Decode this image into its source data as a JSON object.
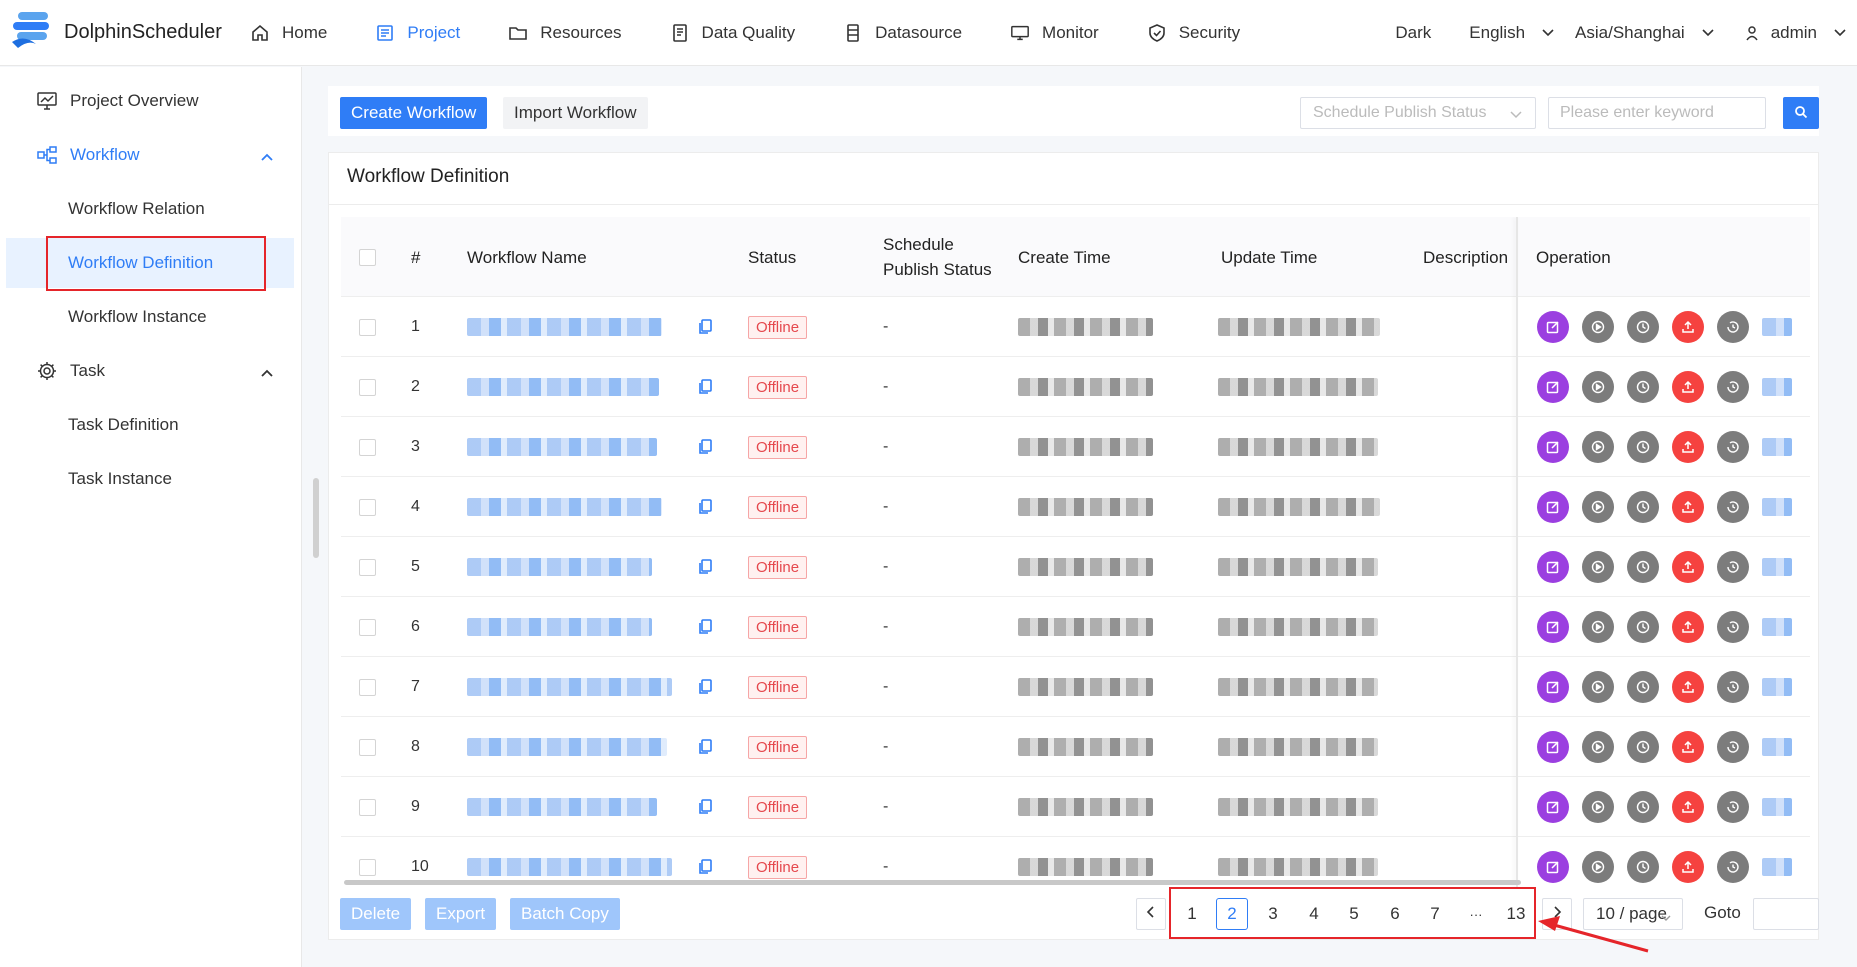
{
  "app": {
    "name": "DolphinScheduler"
  },
  "nav": [
    {
      "label": "Home",
      "icon": "home-icon"
    },
    {
      "label": "Project",
      "icon": "project-icon",
      "active": true
    },
    {
      "label": "Resources",
      "icon": "folder-icon"
    },
    {
      "label": "Data Quality",
      "icon": "data-quality-icon"
    },
    {
      "label": "Datasource",
      "icon": "datasource-icon"
    },
    {
      "label": "Monitor",
      "icon": "monitor-icon"
    },
    {
      "label": "Security",
      "icon": "shield-icon"
    }
  ],
  "header_right": {
    "theme": "Dark",
    "language": "English",
    "timezone": "Asia/Shanghai",
    "user": "admin"
  },
  "sidebar": {
    "project_overview": "Project Overview",
    "workflow": "Workflow",
    "workflow_relation": "Workflow Relation",
    "workflow_definition": "Workflow Definition",
    "workflow_instance": "Workflow Instance",
    "task": "Task",
    "task_definition": "Task Definition",
    "task_instance": "Task Instance"
  },
  "toolbar": {
    "create_label": "Create Workflow",
    "import_label": "Import Workflow",
    "status_placeholder": "Schedule Publish Status",
    "keyword_placeholder": "Please enter keyword"
  },
  "card": {
    "title": "Workflow Definition"
  },
  "table": {
    "headers": {
      "index": "#",
      "name": "Workflow Name",
      "status": "Status",
      "schedule_line1": "Schedule",
      "schedule_line2": "Publish Status",
      "create_time": "Create Time",
      "update_time": "Update Time",
      "description": "Description",
      "operation": "Operation"
    },
    "rows": [
      {
        "index": "1",
        "status": "Offline",
        "schedule": "-"
      },
      {
        "index": "2",
        "status": "Offline",
        "schedule": "-"
      },
      {
        "index": "3",
        "status": "Offline",
        "schedule": "-"
      },
      {
        "index": "4",
        "status": "Offline",
        "schedule": "-"
      },
      {
        "index": "5",
        "status": "Offline",
        "schedule": "-"
      },
      {
        "index": "6",
        "status": "Offline",
        "schedule": "-"
      },
      {
        "index": "7",
        "status": "Offline",
        "schedule": "-"
      },
      {
        "index": "8",
        "status": "Offline",
        "schedule": "-"
      },
      {
        "index": "9",
        "status": "Offline",
        "schedule": "-"
      },
      {
        "index": "10",
        "status": "Offline",
        "schedule": "-"
      }
    ]
  },
  "footer": {
    "delete_label": "Delete",
    "export_label": "Export",
    "batch_copy_label": "Batch Copy"
  },
  "pagination": {
    "pages": [
      "1",
      "2",
      "3",
      "4",
      "5",
      "6",
      "7",
      "···",
      "13"
    ],
    "current": "2",
    "page_size": "10 / page",
    "goto_label": "Goto"
  },
  "colors": {
    "primary": "#2f7df6",
    "edit": "#9b3fe0",
    "danger": "#f5423f",
    "neutral": "#7c7c7c",
    "annotation": "#e5252a"
  }
}
